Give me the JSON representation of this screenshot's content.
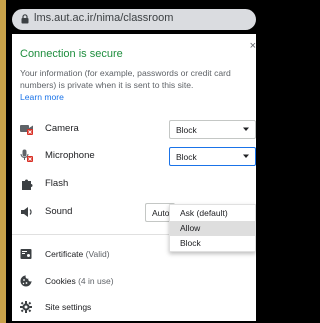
{
  "browser": {
    "url": "lms.aut.ac.ir/nima/classroom"
  },
  "popup": {
    "title": "Connection is secure",
    "description": "Your information (for example, passwords or credit card numbers) is private when it is sent to this site.",
    "learn_more": "Learn more",
    "close_glyph": "×",
    "permissions": [
      {
        "label": "Camera",
        "value": "Block",
        "icon": "camera-blocked-icon"
      },
      {
        "label": "Microphone",
        "value": "Block",
        "icon": "microphone-blocked-icon"
      },
      {
        "label": "Flash",
        "value": "",
        "icon": "puzzle-icon"
      },
      {
        "label": "Sound",
        "value": "Auto",
        "icon": "speaker-icon"
      }
    ],
    "dropdown": {
      "options": [
        "Ask (default)",
        "Allow",
        "Block"
      ],
      "highlighted": "Allow"
    },
    "links": [
      {
        "label": "Certificate",
        "sub": "(Valid)",
        "icon": "certificate-icon"
      },
      {
        "label": "Cookies",
        "sub": "(4 in use)",
        "icon": "cookie-icon"
      },
      {
        "label": "Site settings",
        "sub": "",
        "icon": "gear-icon"
      }
    ]
  },
  "colors": {
    "secure_green": "#1e8e3e",
    "link_blue": "#1a73e8",
    "block_red": "#d93025",
    "frame_border": "#c9a24a"
  }
}
